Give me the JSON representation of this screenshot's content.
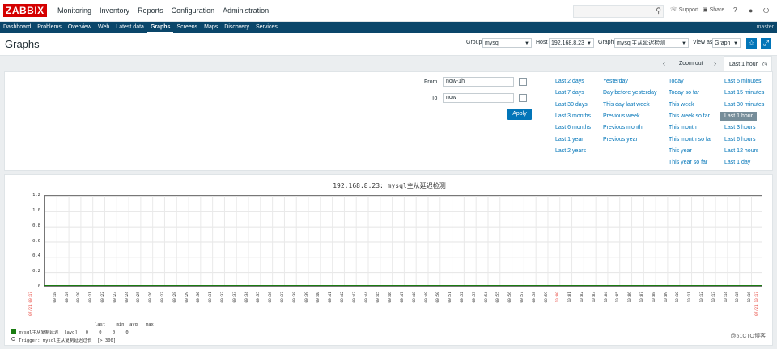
{
  "logo": "ZABBIX",
  "main_nav": [
    "Monitoring",
    "Inventory",
    "Reports",
    "Configuration",
    "Administration"
  ],
  "topright": {
    "support": "Support",
    "share": "Share",
    "help": "?",
    "user_icon": "user-icon",
    "power_icon": "power-icon"
  },
  "sub_nav": [
    "Dashboard",
    "Problems",
    "Overview",
    "Web",
    "Latest data",
    "Graphs",
    "Screens",
    "Maps",
    "Discovery",
    "Services"
  ],
  "sub_nav_active": "Graphs",
  "username": "master",
  "page_title": "Graphs",
  "filters": {
    "group_label": "Group",
    "group_value": "mysql",
    "host_label": "Host",
    "host_value": "192.168.8.23",
    "graph_label": "Graph",
    "graph_value": "mysql主从延迟检测",
    "view_label": "View as",
    "view_value": "Graph"
  },
  "timebar": {
    "zoom_out": "Zoom out",
    "active_tab": "Last 1 hour"
  },
  "time_filter": {
    "from_label": "From",
    "from_value": "now-1h",
    "to_label": "To",
    "to_value": "now",
    "apply": "Apply"
  },
  "quick_ranges": {
    "col1": [
      "Last 2 days",
      "Last 7 days",
      "Last 30 days",
      "Last 3 months",
      "Last 6 months",
      "Last 1 year",
      "Last 2 years"
    ],
    "col2": [
      "Yesterday",
      "Day before yesterday",
      "This day last week",
      "Previous week",
      "Previous month",
      "Previous year"
    ],
    "col3": [
      "Today",
      "Today so far",
      "This week",
      "This week so far",
      "This month",
      "This month so far",
      "This year",
      "This year so far"
    ],
    "col4": [
      "Last 5 minutes",
      "Last 15 minutes",
      "Last 30 minutes",
      "Last 1 hour",
      "Last 3 hours",
      "Last 6 hours",
      "Last 12 hours",
      "Last 1 day"
    ],
    "selected": "Last 1 hour"
  },
  "chart_data": {
    "type": "line",
    "title": "192.168.8.23: mysql主从延迟检测",
    "y_ticks": [
      "1.2",
      "1.0",
      "0.8",
      "0.6",
      "0.4",
      "0.2",
      "0"
    ],
    "ylim": [
      0,
      1.2
    ],
    "x_start_label": "07/21 09:17",
    "x_end_label": "07/21 10:17",
    "x_ticks": [
      "09:18",
      "09:19",
      "09:20",
      "09:21",
      "09:22",
      "09:23",
      "09:24",
      "09:25",
      "09:26",
      "09:27",
      "09:28",
      "09:29",
      "09:30",
      "09:31",
      "09:32",
      "09:33",
      "09:34",
      "09:35",
      "09:36",
      "09:37",
      "09:38",
      "09:39",
      "09:40",
      "09:41",
      "09:42",
      "09:43",
      "09:44",
      "09:45",
      "09:46",
      "09:47",
      "09:48",
      "09:49",
      "09:50",
      "09:51",
      "09:52",
      "09:53",
      "09:54",
      "09:55",
      "09:56",
      "09:57",
      "09:58",
      "09:59",
      "10:00",
      "10:01",
      "10:02",
      "10:03",
      "10:04",
      "10:05",
      "10:06",
      "10:07",
      "10:08",
      "10:09",
      "10:10",
      "10:11",
      "10:12",
      "10:13",
      "10:14",
      "10:15",
      "10:16"
    ],
    "red_tick": "10:00",
    "series": [
      {
        "name": "mysql主从复制延迟",
        "color": "#1a7c11",
        "last": 0,
        "min": 0,
        "avg": 0,
        "max": 0,
        "agg": "[avg]"
      }
    ],
    "legend_header": [
      "last",
      "min",
      "avg",
      "max"
    ],
    "trigger": "Trigger: mysql主从复制延迟过长  [> 300]",
    "grid": true
  },
  "watermark": "@51CTO博客"
}
